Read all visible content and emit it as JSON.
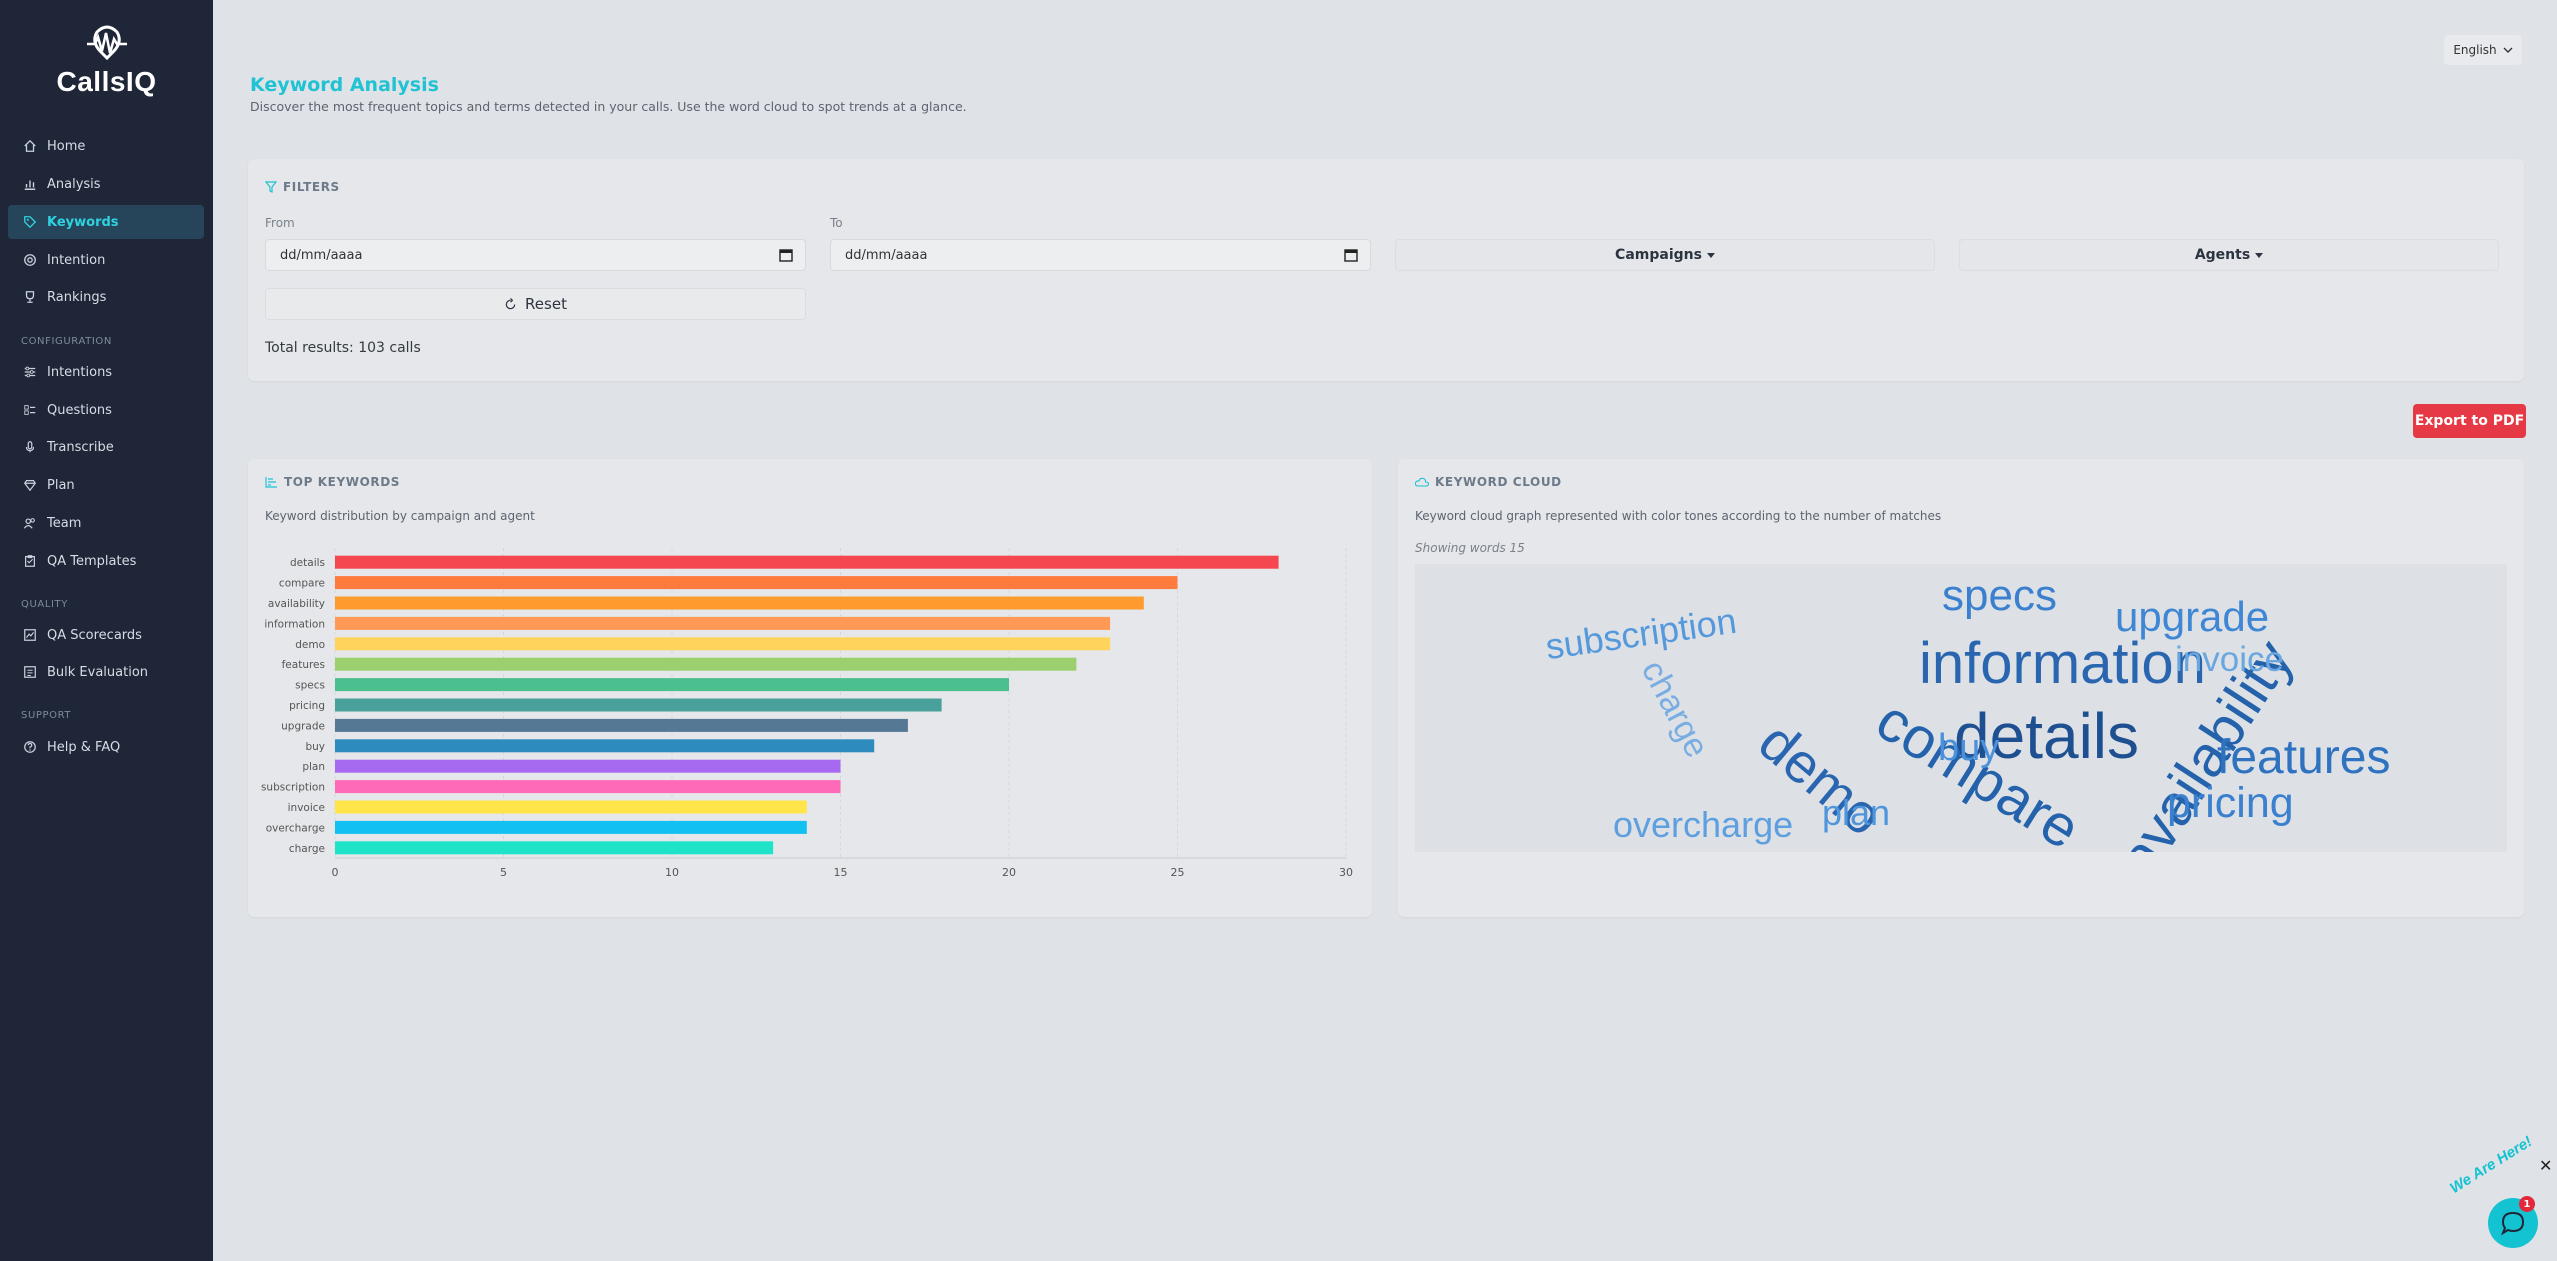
{
  "app": {
    "logo_text": "CallsIQ",
    "language": "English"
  },
  "sidebar": {
    "items": [
      {
        "label": "Home",
        "icon": "home-icon"
      },
      {
        "label": "Analysis",
        "icon": "bar-chart-icon"
      },
      {
        "label": "Keywords",
        "icon": "tag-icon",
        "active": true
      },
      {
        "label": "Intention",
        "icon": "target-icon"
      },
      {
        "label": "Rankings",
        "icon": "trophy-icon"
      }
    ],
    "configuration_title": "CONFIGURATION",
    "configuration_items": [
      {
        "label": "Intentions",
        "icon": "sliders-icon"
      },
      {
        "label": "Questions",
        "icon": "list-check-icon"
      },
      {
        "label": "Transcribe",
        "icon": "microphone-icon"
      },
      {
        "label": "Plan",
        "icon": "diamond-icon"
      },
      {
        "label": "Team",
        "icon": "users-icon"
      },
      {
        "label": "QA Templates",
        "icon": "clipboard-icon"
      }
    ],
    "quality_title": "QUALITY",
    "quality_items": [
      {
        "label": "QA Scorecards",
        "icon": "scorecard-icon"
      },
      {
        "label": "Bulk Evaluation",
        "icon": "bulk-icon"
      }
    ],
    "support_title": "SUPPORT",
    "support_items": [
      {
        "label": "Help & FAQ",
        "icon": "help-icon"
      }
    ]
  },
  "header": {
    "title": "Keyword Analysis",
    "subtitle": "Discover the most frequent topics and terms detected in your calls. Use the word cloud to spot trends at a glance."
  },
  "filters": {
    "title": "FILTERS",
    "from_label": "From",
    "from_placeholder": "dd/mm/aaaa",
    "to_label": "To",
    "to_placeholder": "dd/mm/aaaa",
    "campaigns_label": "Campaigns",
    "agents_label": "Agents",
    "reset_label": "Reset",
    "total_results": "Total results: 103 calls"
  },
  "export_label": "Export to PDF",
  "top_keywords": {
    "title": "TOP KEYWORDS",
    "description": "Keyword distribution by campaign and agent"
  },
  "keyword_cloud": {
    "title": "KEYWORD CLOUD",
    "description": "Keyword cloud graph represented with color tones according to the number of matches",
    "showing": "Showing words 15",
    "words": [
      {
        "text": "details",
        "value": 28
      },
      {
        "text": "compare",
        "value": 25
      },
      {
        "text": "availability",
        "value": 24
      },
      {
        "text": "information",
        "value": 23
      },
      {
        "text": "demo",
        "value": 23
      },
      {
        "text": "features",
        "value": 22
      },
      {
        "text": "specs",
        "value": 20
      },
      {
        "text": "pricing",
        "value": 18
      },
      {
        "text": "upgrade",
        "value": 17
      },
      {
        "text": "buy",
        "value": 16
      },
      {
        "text": "plan",
        "value": 15
      },
      {
        "text": "subscription",
        "value": 15
      },
      {
        "text": "invoice",
        "value": 14
      },
      {
        "text": "overcharge",
        "value": 14
      },
      {
        "text": "charge",
        "value": 13
      }
    ]
  },
  "chart_data": {
    "type": "bar",
    "orientation": "horizontal",
    "categories": [
      "details",
      "compare",
      "availability",
      "information",
      "demo",
      "features",
      "specs",
      "pricing",
      "upgrade",
      "buy",
      "plan",
      "subscription",
      "invoice",
      "overcharge",
      "charge"
    ],
    "values": [
      28,
      25,
      24,
      23,
      23,
      22,
      20,
      18,
      17,
      16,
      15,
      15,
      14,
      14,
      13
    ],
    "colors": [
      "#f4474f",
      "#ff7a3d",
      "#ff9a2e",
      "#ff9955",
      "#ffd35c",
      "#9ccf6e",
      "#4cbf8f",
      "#4aa09a",
      "#557895",
      "#2e8bbd",
      "#a66af0",
      "#ff6ab8",
      "#ffe54a",
      "#12c1f1",
      "#1de3c8"
    ],
    "xlim": [
      0,
      30
    ],
    "xticks": [
      0,
      5,
      10,
      15,
      20,
      25,
      30
    ],
    "grid": true
  },
  "chat_widget": {
    "banner": "We Are Here!",
    "badge": "1"
  }
}
